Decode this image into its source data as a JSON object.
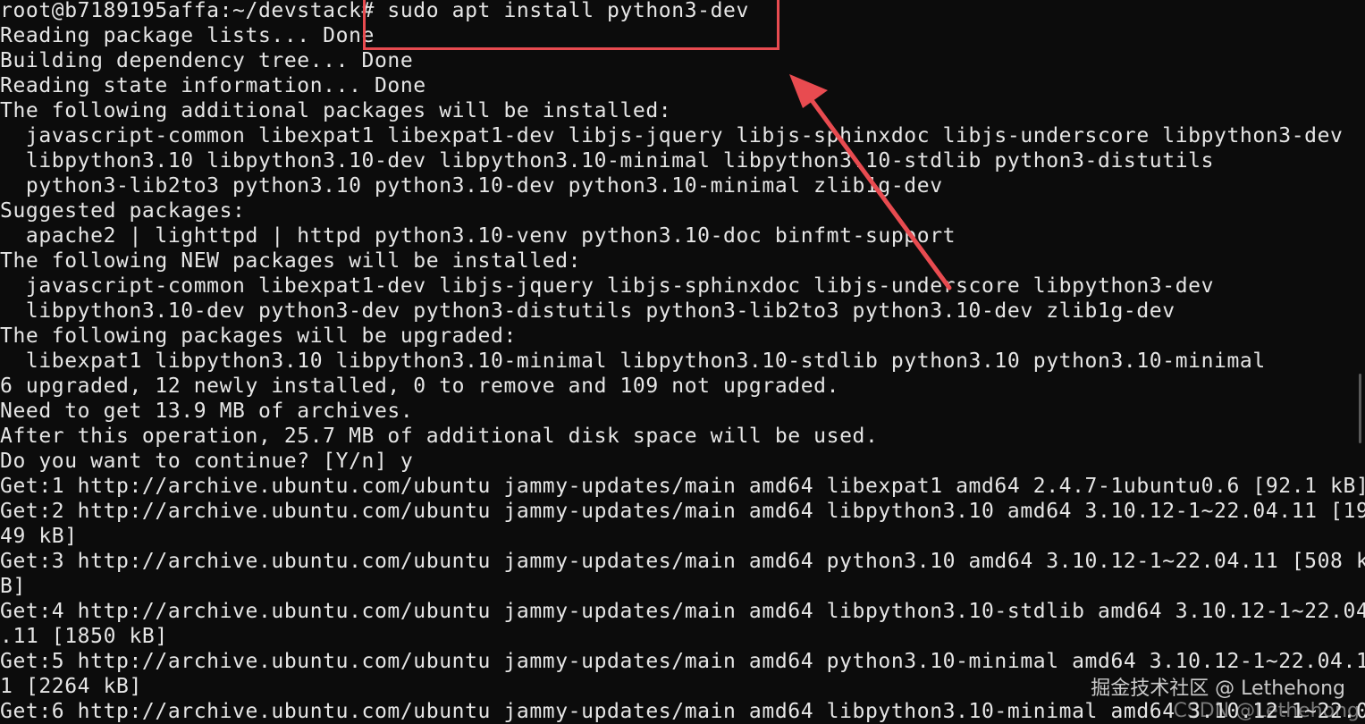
{
  "terminal": {
    "lines": [
      "root@b7189195affa:~/devstack# sudo apt install python3-dev",
      "Reading package lists... Done",
      "Building dependency tree... Done",
      "Reading state information... Done",
      "The following additional packages will be installed:",
      "  javascript-common libexpat1 libexpat1-dev libjs-jquery libjs-sphinxdoc libjs-underscore libpython3-dev",
      "  libpython3.10 libpython3.10-dev libpython3.10-minimal libpython3.10-stdlib python3-distutils",
      "  python3-lib2to3 python3.10 python3.10-dev python3.10-minimal zlib1g-dev",
      "Suggested packages:",
      "  apache2 | lighttpd | httpd python3.10-venv python3.10-doc binfmt-support",
      "The following NEW packages will be installed:",
      "  javascript-common libexpat1-dev libjs-jquery libjs-sphinxdoc libjs-underscore libpython3-dev",
      "  libpython3.10-dev python3-dev python3-distutils python3-lib2to3 python3.10-dev zlib1g-dev",
      "The following packages will be upgraded:",
      "  libexpat1 libpython3.10 libpython3.10-minimal libpython3.10-stdlib python3.10 python3.10-minimal",
      "6 upgraded, 12 newly installed, 0 to remove and 109 not upgraded.",
      "Need to get 13.9 MB of archives.",
      "After this operation, 25.7 MB of additional disk space will be used.",
      "Do you want to continue? [Y/n] y",
      "Get:1 http://archive.ubuntu.com/ubuntu jammy-updates/main amd64 libexpat1 amd64 2.4.7-1ubuntu0.6 [92.1 kB]",
      "Get:2 http://archive.ubuntu.com/ubuntu jammy-updates/main amd64 libpython3.10 amd64 3.10.12-1~22.04.11 [19",
      "49 kB]",
      "Get:3 http://archive.ubuntu.com/ubuntu jammy-updates/main amd64 python3.10 amd64 3.10.12-1~22.04.11 [508 k",
      "B]",
      "Get:4 http://archive.ubuntu.com/ubuntu jammy-updates/main amd64 libpython3.10-stdlib amd64 3.10.12-1~22.04",
      ".11 [1850 kB]",
      "Get:5 http://archive.ubuntu.com/ubuntu jammy-updates/main amd64 python3.10-minimal amd64 3.10.12-1~22.04.1",
      "1 [2264 kB]",
      "Get:6 http://archive.ubuntu.com/ubuntu jammy-updates/main amd64 libpython3.10-minimal amd64 3.10.12-1~22.0"
    ]
  },
  "annotation": {
    "box_color": "#e84b50"
  },
  "watermark": {
    "primary": "掘金技术社区 @ Lethehong",
    "secondary": "CSDN @Lethehong"
  }
}
